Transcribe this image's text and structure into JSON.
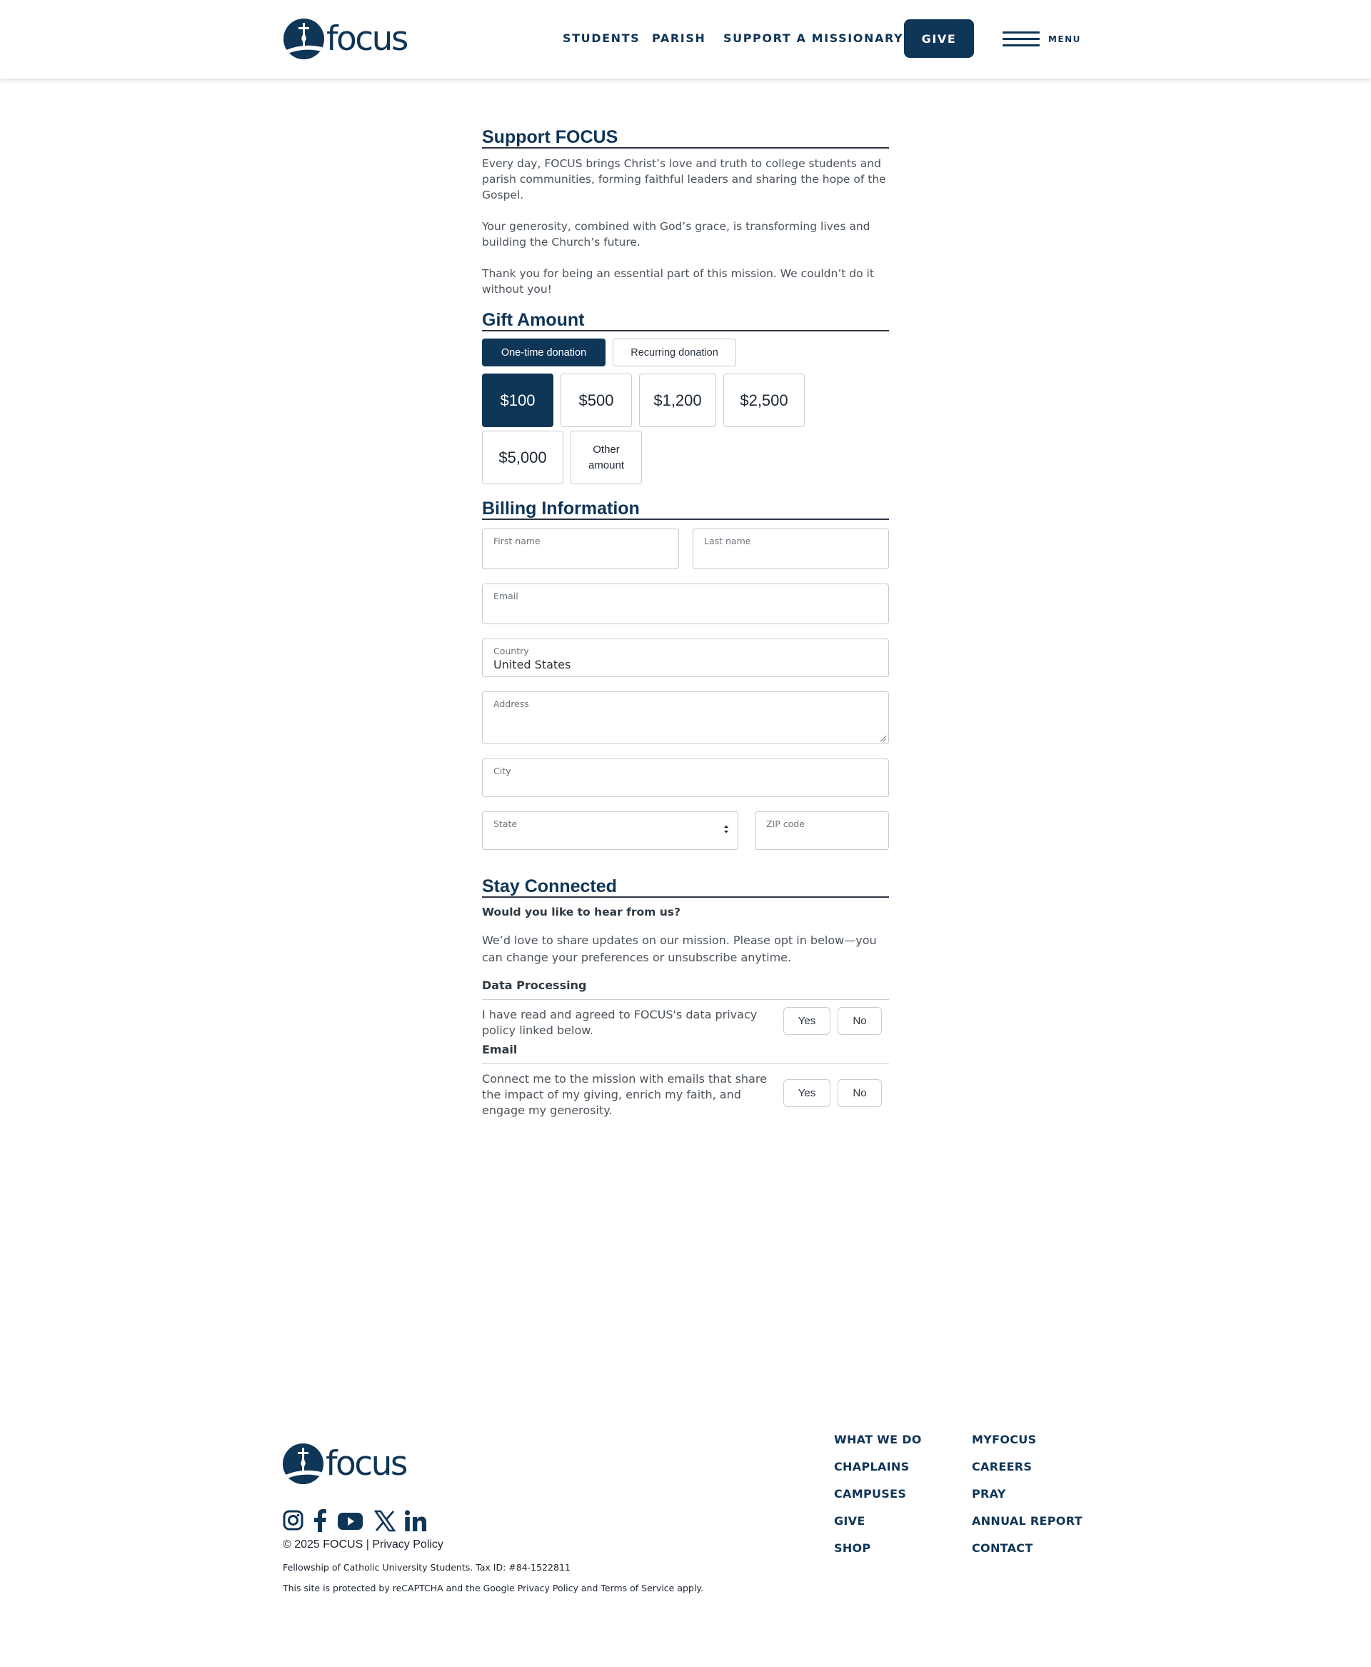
{
  "header": {
    "logo_text": "focus",
    "nav": [
      "STUDENTS",
      "PARISH",
      "SUPPORT A MISSIONARY"
    ],
    "give_label": "GIVE",
    "menu_label": "MENU"
  },
  "support": {
    "title": "Support FOCUS",
    "paragraphs": [
      "Every day, FOCUS brings Christ’s love and truth to college students and parish communities, forming faithful leaders and sharing the hope of the Gospel.",
      "Your generosity, combined with God’s grace, is transforming lives and building the Church’s future.",
      "Thank you for being an essential part of this mission. We couldn’t do it without you!"
    ]
  },
  "gift": {
    "title": "Gift Amount",
    "frequency": [
      "One-time donation",
      "Recurring donation"
    ],
    "frequency_selected": "One-time donation",
    "amounts": [
      "$100",
      "$500",
      "$1,200",
      "$2,500",
      "$5,000"
    ],
    "other_line1": "Other",
    "other_line2": "amount",
    "amount_selected": "$100"
  },
  "billing": {
    "title": "Billing Information",
    "first_name_label": "First name",
    "last_name_label": "Last name",
    "email_label": "Email",
    "country_label": "Country",
    "country_value": "United States",
    "address_label": "Address",
    "city_label": "City",
    "state_label": "State",
    "zip_label": "ZIP code"
  },
  "connected": {
    "title": "Stay Connected",
    "question": "Would you like to hear from us?",
    "intro": "We’d love to share updates on our mission. Please opt in below—you can change your preferences or unsubscribe anytime.",
    "data_processing_head": "Data Processing",
    "data_processing_text": "I have read and agreed to FOCUS's data privacy policy linked below.",
    "email_head": "Email",
    "email_text": "Connect me to the mission with emails that share the impact of my giving, enrich my faith, and engage my generosity.",
    "yes_label": "Yes",
    "no_label": "No"
  },
  "footer": {
    "logo_text": "focus",
    "col1": [
      "WHAT WE DO",
      "CHAPLAINS",
      "CAMPUSES",
      "GIVE",
      "SHOP"
    ],
    "col2": [
      "MYFOCUS",
      "CAREERS",
      "PRAY",
      "ANNUAL REPORT",
      "CONTACT"
    ],
    "social_icons": [
      "instagram-icon",
      "facebook-icon",
      "youtube-icon",
      "x-icon",
      "linkedin-icon"
    ],
    "copyright": "© 2025 FOCUS",
    "separator": "|",
    "privacy_link": "Privacy Policy",
    "tax_line": "Fellowship of Catholic University Students. Tax ID: #84-1522811",
    "recaptcha_line": "This site is protected by reCAPTCHA and the Google Privacy Policy and Terms of Service apply."
  },
  "colors": {
    "brand_navy": "#0f3557",
    "text_gray": "#4b535b",
    "border": "#c8ccd0"
  }
}
